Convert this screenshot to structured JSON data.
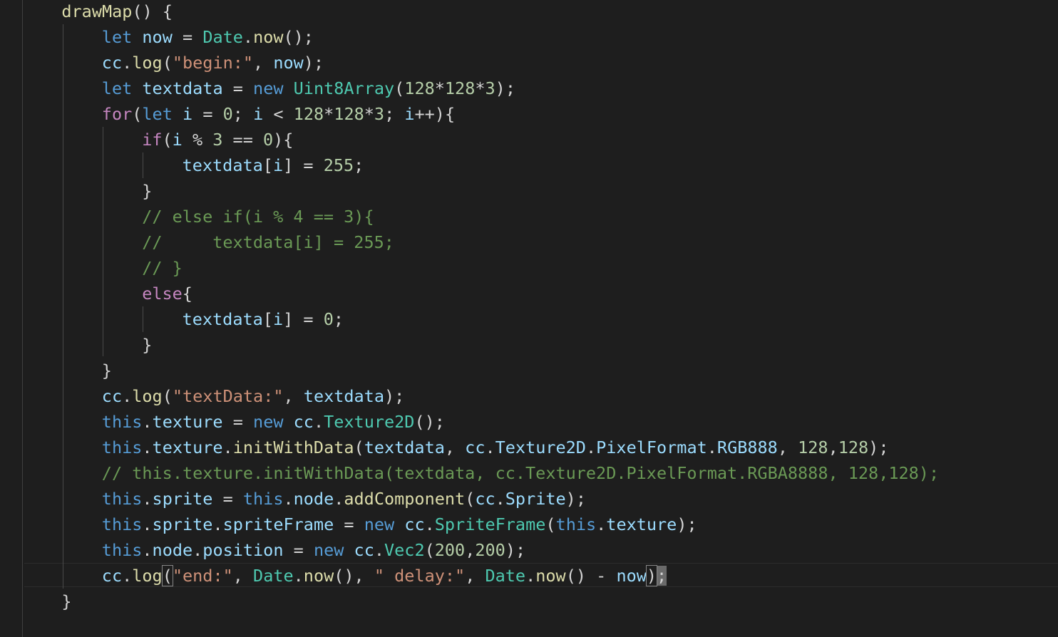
{
  "lines": [
    {
      "indent": 1,
      "tokens": [
        [
          "fn",
          "drawMap"
        ],
        [
          "pun",
          "() {"
        ]
      ]
    },
    {
      "indent": 2,
      "tokens": [
        [
          "kw",
          "let"
        ],
        [
          "pun",
          " "
        ],
        [
          "var",
          "now"
        ],
        [
          "pun",
          " = "
        ],
        [
          "cls",
          "Date"
        ],
        [
          "pun",
          "."
        ],
        [
          "fn",
          "now"
        ],
        [
          "pun",
          "();"
        ]
      ]
    },
    {
      "indent": 2,
      "tokens": [
        [
          "var",
          "cc"
        ],
        [
          "pun",
          "."
        ],
        [
          "fn",
          "log"
        ],
        [
          "pun",
          "("
        ],
        [
          "str",
          "\"begin:\""
        ],
        [
          "pun",
          ", "
        ],
        [
          "var",
          "now"
        ],
        [
          "pun",
          ");"
        ]
      ]
    },
    {
      "indent": 2,
      "tokens": [
        [
          "kw",
          "let"
        ],
        [
          "pun",
          " "
        ],
        [
          "var",
          "textdata"
        ],
        [
          "pun",
          " = "
        ],
        [
          "kw",
          "new"
        ],
        [
          "pun",
          " "
        ],
        [
          "cls",
          "Uint8Array"
        ],
        [
          "pun",
          "("
        ],
        [
          "num",
          "128"
        ],
        [
          "pun",
          "*"
        ],
        [
          "num",
          "128"
        ],
        [
          "pun",
          "*"
        ],
        [
          "num",
          "3"
        ],
        [
          "pun",
          ");"
        ]
      ]
    },
    {
      "indent": 2,
      "tokens": [
        [
          "ctl",
          "for"
        ],
        [
          "pun",
          "("
        ],
        [
          "kw",
          "let"
        ],
        [
          "pun",
          " "
        ],
        [
          "var",
          "i"
        ],
        [
          "pun",
          " = "
        ],
        [
          "num",
          "0"
        ],
        [
          "pun",
          "; "
        ],
        [
          "var",
          "i"
        ],
        [
          "pun",
          " < "
        ],
        [
          "num",
          "128"
        ],
        [
          "pun",
          "*"
        ],
        [
          "num",
          "128"
        ],
        [
          "pun",
          "*"
        ],
        [
          "num",
          "3"
        ],
        [
          "pun",
          "; "
        ],
        [
          "var",
          "i"
        ],
        [
          "pun",
          "++){"
        ]
      ]
    },
    {
      "indent": 3,
      "tokens": [
        [
          "ctl",
          "if"
        ],
        [
          "pun",
          "("
        ],
        [
          "var",
          "i"
        ],
        [
          "pun",
          " % "
        ],
        [
          "num",
          "3"
        ],
        [
          "pun",
          " == "
        ],
        [
          "num",
          "0"
        ],
        [
          "pun",
          "){"
        ]
      ]
    },
    {
      "indent": 4,
      "tokens": [
        [
          "var",
          "textdata"
        ],
        [
          "pun",
          "["
        ],
        [
          "var",
          "i"
        ],
        [
          "pun",
          "] = "
        ],
        [
          "num",
          "255"
        ],
        [
          "pun",
          ";"
        ]
      ]
    },
    {
      "indent": 3,
      "tokens": [
        [
          "pun",
          "}"
        ]
      ]
    },
    {
      "indent": 3,
      "tokens": [
        [
          "cmt",
          "// else if(i % 4 == 3){"
        ]
      ]
    },
    {
      "indent": 3,
      "tokens": [
        [
          "cmt",
          "//     textdata[i] = 255;"
        ]
      ]
    },
    {
      "indent": 3,
      "tokens": [
        [
          "cmt",
          "// }"
        ]
      ]
    },
    {
      "indent": 3,
      "tokens": [
        [
          "ctl",
          "else"
        ],
        [
          "pun",
          "{"
        ]
      ]
    },
    {
      "indent": 4,
      "tokens": [
        [
          "var",
          "textdata"
        ],
        [
          "pun",
          "["
        ],
        [
          "var",
          "i"
        ],
        [
          "pun",
          "] = "
        ],
        [
          "num",
          "0"
        ],
        [
          "pun",
          ";"
        ]
      ]
    },
    {
      "indent": 3,
      "tokens": [
        [
          "pun",
          "}"
        ]
      ]
    },
    {
      "indent": 2,
      "tokens": [
        [
          "pun",
          "}"
        ]
      ]
    },
    {
      "indent": 2,
      "tokens": [
        [
          "var",
          "cc"
        ],
        [
          "pun",
          "."
        ],
        [
          "fn",
          "log"
        ],
        [
          "pun",
          "("
        ],
        [
          "str",
          "\"textData:\""
        ],
        [
          "pun",
          ", "
        ],
        [
          "var",
          "textdata"
        ],
        [
          "pun",
          ");"
        ]
      ]
    },
    {
      "indent": 2,
      "tokens": [
        [
          "kw",
          "this"
        ],
        [
          "pun",
          "."
        ],
        [
          "var",
          "texture"
        ],
        [
          "pun",
          " = "
        ],
        [
          "kw",
          "new"
        ],
        [
          "pun",
          " "
        ],
        [
          "var",
          "cc"
        ],
        [
          "pun",
          "."
        ],
        [
          "cls",
          "Texture2D"
        ],
        [
          "pun",
          "();"
        ]
      ]
    },
    {
      "indent": 2,
      "tokens": [
        [
          "kw",
          "this"
        ],
        [
          "pun",
          "."
        ],
        [
          "var",
          "texture"
        ],
        [
          "pun",
          "."
        ],
        [
          "fn",
          "initWithData"
        ],
        [
          "pun",
          "("
        ],
        [
          "var",
          "textdata"
        ],
        [
          "pun",
          ", "
        ],
        [
          "var",
          "cc"
        ],
        [
          "pun",
          "."
        ],
        [
          "var",
          "Texture2D"
        ],
        [
          "pun",
          "."
        ],
        [
          "var",
          "PixelFormat"
        ],
        [
          "pun",
          "."
        ],
        [
          "var",
          "RGB888"
        ],
        [
          "pun",
          ", "
        ],
        [
          "num",
          "128"
        ],
        [
          "pun",
          ","
        ],
        [
          "num",
          "128"
        ],
        [
          "pun",
          ");"
        ]
      ]
    },
    {
      "indent": 2,
      "tokens": [
        [
          "cmt",
          "// this.texture.initWithData(textdata, cc.Texture2D.PixelFormat.RGBA8888, 128,128);"
        ]
      ]
    },
    {
      "indent": 2,
      "tokens": [
        [
          "kw",
          "this"
        ],
        [
          "pun",
          "."
        ],
        [
          "var",
          "sprite"
        ],
        [
          "pun",
          " = "
        ],
        [
          "kw",
          "this"
        ],
        [
          "pun",
          "."
        ],
        [
          "var",
          "node"
        ],
        [
          "pun",
          "."
        ],
        [
          "fn",
          "addComponent"
        ],
        [
          "pun",
          "("
        ],
        [
          "var",
          "cc"
        ],
        [
          "pun",
          "."
        ],
        [
          "var",
          "Sprite"
        ],
        [
          "pun",
          ");"
        ]
      ]
    },
    {
      "indent": 2,
      "tokens": [
        [
          "kw",
          "this"
        ],
        [
          "pun",
          "."
        ],
        [
          "var",
          "sprite"
        ],
        [
          "pun",
          "."
        ],
        [
          "var",
          "spriteFrame"
        ],
        [
          "pun",
          " = "
        ],
        [
          "kw",
          "new"
        ],
        [
          "pun",
          " "
        ],
        [
          "var",
          "cc"
        ],
        [
          "pun",
          "."
        ],
        [
          "cls",
          "SpriteFrame"
        ],
        [
          "pun",
          "("
        ],
        [
          "kw",
          "this"
        ],
        [
          "pun",
          "."
        ],
        [
          "var",
          "texture"
        ],
        [
          "pun",
          ");"
        ]
      ]
    },
    {
      "indent": 2,
      "tokens": [
        [
          "kw",
          "this"
        ],
        [
          "pun",
          "."
        ],
        [
          "var",
          "node"
        ],
        [
          "pun",
          "."
        ],
        [
          "var",
          "position"
        ],
        [
          "pun",
          " = "
        ],
        [
          "kw",
          "new"
        ],
        [
          "pun",
          " "
        ],
        [
          "var",
          "cc"
        ],
        [
          "pun",
          "."
        ],
        [
          "cls",
          "Vec2"
        ],
        [
          "pun",
          "("
        ],
        [
          "num",
          "200"
        ],
        [
          "pun",
          ","
        ],
        [
          "num",
          "200"
        ],
        [
          "pun",
          ");"
        ]
      ]
    },
    {
      "indent": 2,
      "tokens": [
        [
          "var",
          "cc"
        ],
        [
          "pun",
          "."
        ],
        [
          "fn",
          "log"
        ],
        [
          "pun",
          "("
        ],
        [
          "str",
          "\"end:\""
        ],
        [
          "pun",
          ", "
        ],
        [
          "cls",
          "Date"
        ],
        [
          "pun",
          "."
        ],
        [
          "fn",
          "now"
        ],
        [
          "pun",
          "(), "
        ],
        [
          "str",
          "\" delay:\""
        ],
        [
          "pun",
          ", "
        ],
        [
          "cls",
          "Date"
        ],
        [
          "pun",
          "."
        ],
        [
          "fn",
          "now"
        ],
        [
          "pun",
          "() - "
        ],
        [
          "var",
          "now"
        ],
        [
          "pun",
          ")"
        ],
        [
          "pun",
          ";"
        ]
      ]
    },
    {
      "indent": 1,
      "tokens": [
        [
          "pun",
          "}"
        ]
      ]
    }
  ],
  "colors": {
    "background": "#1e1e1e",
    "keyword": "#569cd6",
    "control": "#c586c0",
    "variable": "#9cdcfe",
    "function": "#dcdcaa",
    "class": "#4ec9b0",
    "string": "#ce9178",
    "number": "#b5cea8",
    "comment": "#6a9955"
  }
}
